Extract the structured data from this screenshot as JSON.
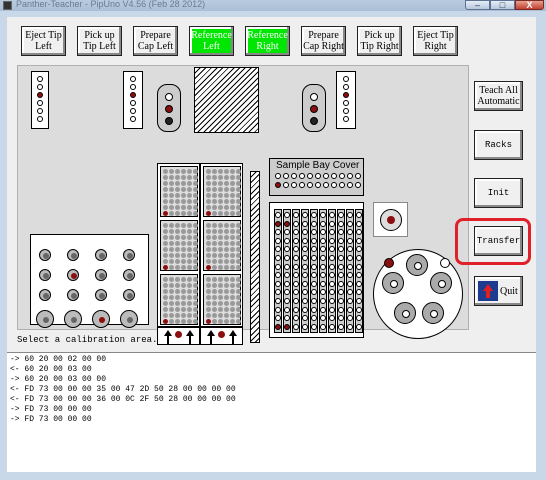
{
  "window": {
    "title": "Panther-Teacher - PipUno     V4.56 (Feb 28 2012)",
    "controls": {
      "minimize": "–",
      "maximize": "□",
      "close": "X"
    }
  },
  "toolbar": {
    "buttons": [
      {
        "label": "Eject Tip\nLeft",
        "active": false
      },
      {
        "label": "Pick up\nTip Left",
        "active": false
      },
      {
        "label": "Prepare\nCap Left",
        "active": false
      },
      {
        "label": "Reference\nLeft",
        "active": true
      },
      {
        "label": "Reference\nRight",
        "active": true
      },
      {
        "label": "Prepare\nCap Right",
        "active": false
      },
      {
        "label": "Pick up\nTip Right",
        "active": false
      },
      {
        "label": "Eject Tip\nRight",
        "active": false
      }
    ]
  },
  "side_buttons": {
    "teach_all": "Teach All\nAutomatic",
    "racks": "Racks",
    "init": "Init",
    "transfer": "Transfer",
    "quit": "Quit"
  },
  "deck": {
    "sample_bay_cover": "Sample Bay Cover"
  },
  "status_text": "Select a calibration area.",
  "log_lines": [
    "-> 60 20 00 02 00 00",
    "<- 60 20 00 03 00",
    "-> 60 20 00 03 00 00",
    "<- FD 73 00 00 00 35 00 47 2D 50 28 00 00 00 00",
    "<- FD 73 00 00 00 36 00 0C 2F 50 28 00 00 00 00",
    "-> FD 73 00 00 00",
    "-> FD 73 00 00 00"
  ],
  "colors": {
    "active_button": "#00e600",
    "highlight": "#e0202a",
    "well_dark": "#8b0f0f"
  }
}
